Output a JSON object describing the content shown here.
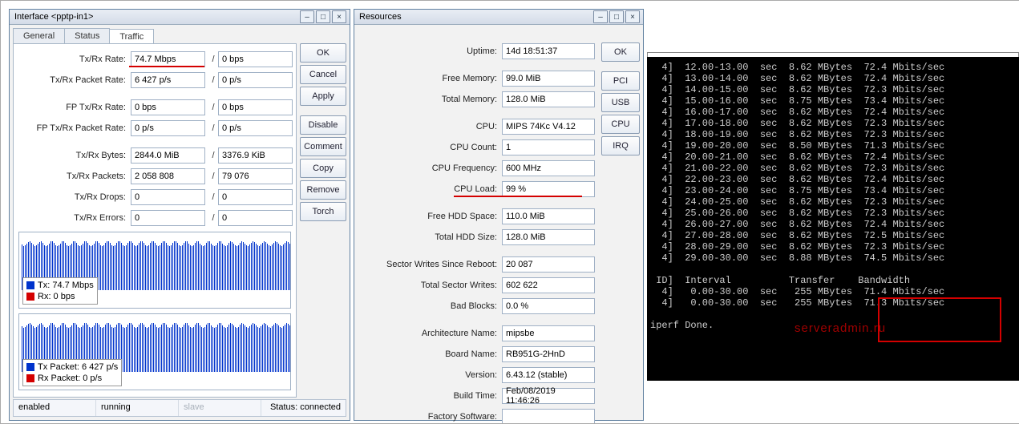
{
  "interfaceWin": {
    "title": "Interface <pptp-in1>",
    "tabs": {
      "general": "General",
      "status": "Status",
      "traffic": "Traffic"
    },
    "buttons": {
      "ok": "OK",
      "cancel": "Cancel",
      "apply": "Apply",
      "disable": "Disable",
      "comment": "Comment",
      "copy": "Copy",
      "remove": "Remove",
      "torch": "Torch"
    },
    "rows": {
      "txrx_rate": {
        "lab": "Tx/Rx Rate:",
        "a": "74.7 Mbps",
        "b": "0 bps"
      },
      "txrx_pkt_rate": {
        "lab": "Tx/Rx Packet Rate:",
        "a": "6 427 p/s",
        "b": "0 p/s"
      },
      "fp_txrx_rate": {
        "lab": "FP Tx/Rx Rate:",
        "a": "0 bps",
        "b": "0 bps"
      },
      "fp_txrx_pkt": {
        "lab": "FP Tx/Rx Packet Rate:",
        "a": "0 p/s",
        "b": "0 p/s"
      },
      "txrx_bytes": {
        "lab": "Tx/Rx Bytes:",
        "a": "2844.0 MiB",
        "b": "3376.9 KiB"
      },
      "txrx_pkts": {
        "lab": "Tx/Rx Packets:",
        "a": "2 058 808",
        "b": "79 076"
      },
      "txrx_drops": {
        "lab": "Tx/Rx Drops:",
        "a": "0",
        "b": "0"
      },
      "txrx_err": {
        "lab": "Tx/Rx Errors:",
        "a": "0",
        "b": "0"
      }
    },
    "legend1": {
      "tx": "Tx: 74.7 Mbps",
      "rx": "Rx: 0 bps"
    },
    "legend2": {
      "tx": "Tx Packet: 6 427 p/s",
      "rx": "Rx Packet: 0 p/s"
    },
    "status": {
      "enabled": "enabled",
      "running": "running",
      "slave": "slave",
      "connected": "Status: connected"
    }
  },
  "resourcesWin": {
    "title": "Resources",
    "buttons": {
      "ok": "OK",
      "pci": "PCI",
      "usb": "USB",
      "cpu": "CPU",
      "irq": "IRQ"
    },
    "rows": {
      "uptime": {
        "lab": "Uptime:",
        "v": "14d 18:51:37"
      },
      "freemem": {
        "lab": "Free Memory:",
        "v": "99.0 MiB"
      },
      "totalmem": {
        "lab": "Total Memory:",
        "v": "128.0 MiB"
      },
      "cpu": {
        "lab": "CPU:",
        "v": "MIPS 74Kc V4.12"
      },
      "cpucount": {
        "lab": "CPU Count:",
        "v": "1"
      },
      "cpufreq": {
        "lab": "CPU Frequency:",
        "v": "600 MHz"
      },
      "cpuload": {
        "lab": "CPU Load:",
        "v": "99 %"
      },
      "freehdd": {
        "lab": "Free HDD Space:",
        "v": "110.0 MiB"
      },
      "totalhdd": {
        "lab": "Total HDD Size:",
        "v": "128.0 MiB"
      },
      "secw": {
        "lab": "Sector Writes Since Reboot:",
        "v": "20 087"
      },
      "tsecw": {
        "lab": "Total Sector Writes:",
        "v": "602 622"
      },
      "bad": {
        "lab": "Bad Blocks:",
        "v": "0.0 %"
      },
      "arch": {
        "lab": "Architecture Name:",
        "v": "mipsbe"
      },
      "board": {
        "lab": "Board Name:",
        "v": "RB951G-2HnD"
      },
      "ver": {
        "lab": "Version:",
        "v": "6.43.12 (stable)"
      },
      "btime": {
        "lab": "Build Time:",
        "v": "Feb/08/2019 11:46:26"
      },
      "fsoft": {
        "lab": "Factory Software:",
        "v": ""
      }
    }
  },
  "terminal": {
    "lines": [
      "  4]  12.00-13.00  sec  8.62 MBytes  72.4 Mbits/sec",
      "  4]  13.00-14.00  sec  8.62 MBytes  72.4 Mbits/sec",
      "  4]  14.00-15.00  sec  8.62 MBytes  72.3 Mbits/sec",
      "  4]  15.00-16.00  sec  8.75 MBytes  73.4 Mbits/sec",
      "  4]  16.00-17.00  sec  8.62 MBytes  72.4 Mbits/sec",
      "  4]  17.00-18.00  sec  8.62 MBytes  72.3 Mbits/sec",
      "  4]  18.00-19.00  sec  8.62 MBytes  72.3 Mbits/sec",
      "  4]  19.00-20.00  sec  8.50 MBytes  71.3 Mbits/sec",
      "  4]  20.00-21.00  sec  8.62 MBytes  72.4 Mbits/sec",
      "  4]  21.00-22.00  sec  8.62 MBytes  72.3 Mbits/sec",
      "  4]  22.00-23.00  sec  8.62 MBytes  72.4 Mbits/sec",
      "  4]  23.00-24.00  sec  8.75 MBytes  73.4 Mbits/sec",
      "  4]  24.00-25.00  sec  8.62 MBytes  72.3 Mbits/sec",
      "  4]  25.00-26.00  sec  8.62 MBytes  72.3 Mbits/sec",
      "  4]  26.00-27.00  sec  8.62 MBytes  72.4 Mbits/sec",
      "  4]  27.00-28.00  sec  8.62 MBytes  72.5 Mbits/sec",
      "  4]  28.00-29.00  sec  8.62 MBytes  72.3 Mbits/sec",
      "  4]  29.00-30.00  sec  8.88 MBytes  74.5 Mbits/sec",
      "",
      " ID]  Interval          Transfer    Bandwidth",
      "  4]   0.00-30.00  sec   255 MBytes  71.4 Mbits/sec",
      "  4]   0.00-30.00  sec   255 MBytes  71.3 Mbits/sec",
      "",
      "iperf Done."
    ],
    "watermark": "serveradmin.ru"
  },
  "chart_data": [
    {
      "type": "line",
      "title": "Tx/Rx Rate",
      "series": [
        {
          "name": "Tx",
          "color": "#0033cc",
          "current": "74.7 Mbps"
        },
        {
          "name": "Rx",
          "color": "#d40000",
          "current": "0 bps"
        }
      ]
    },
    {
      "type": "line",
      "title": "Tx/Rx Packet Rate",
      "series": [
        {
          "name": "Tx Packet",
          "color": "#0033cc",
          "current": "6 427 p/s"
        },
        {
          "name": "Rx Packet",
          "color": "#d40000",
          "current": "0 p/s"
        }
      ]
    }
  ]
}
